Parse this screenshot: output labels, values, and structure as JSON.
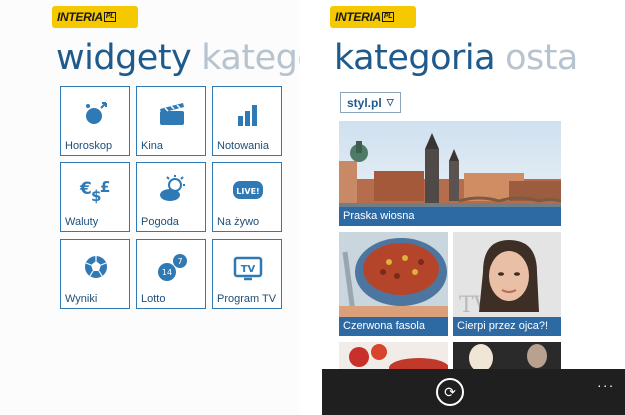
{
  "left": {
    "logo": "INTERIA",
    "logo_suffix": "PL",
    "pivot_active": "widgety",
    "pivot_next": "katego",
    "tiles": [
      {
        "label": "Horoskop",
        "icon": "horoscope-icon"
      },
      {
        "label": "Kina",
        "icon": "clapperboard-icon"
      },
      {
        "label": "Notowania",
        "icon": "bar-chart-icon"
      },
      {
        "label": "Waluty",
        "icon": "currency-icon"
      },
      {
        "label": "Pogoda",
        "icon": "weather-icon"
      },
      {
        "label": "Na żywo",
        "icon": "live-icon",
        "badge": "LIVE!"
      },
      {
        "label": "Wyniki",
        "icon": "football-icon"
      },
      {
        "label": "Lotto",
        "icon": "lotto-icon",
        "numbers": [
          "14",
          "7"
        ]
      },
      {
        "label": "Program TV",
        "icon": "tv-icon",
        "badge": "TV"
      }
    ]
  },
  "right": {
    "logo": "INTERIA",
    "logo_suffix": "PL",
    "pivot_active": "kategoria",
    "pivot_next": "osta",
    "dropdown_value": "styl.pl",
    "cards": [
      {
        "caption": "Praska wiosna"
      },
      {
        "caption": "Czerwona fasola"
      },
      {
        "caption": "Cierpi przez ojca?!"
      }
    ],
    "appbar": {
      "refresh_icon": "refresh-icon",
      "more": "..."
    }
  },
  "colors": {
    "accent": "#2f79b5",
    "caption_bg": "#2d6aa3",
    "logo_yellow": "#f6c800"
  }
}
